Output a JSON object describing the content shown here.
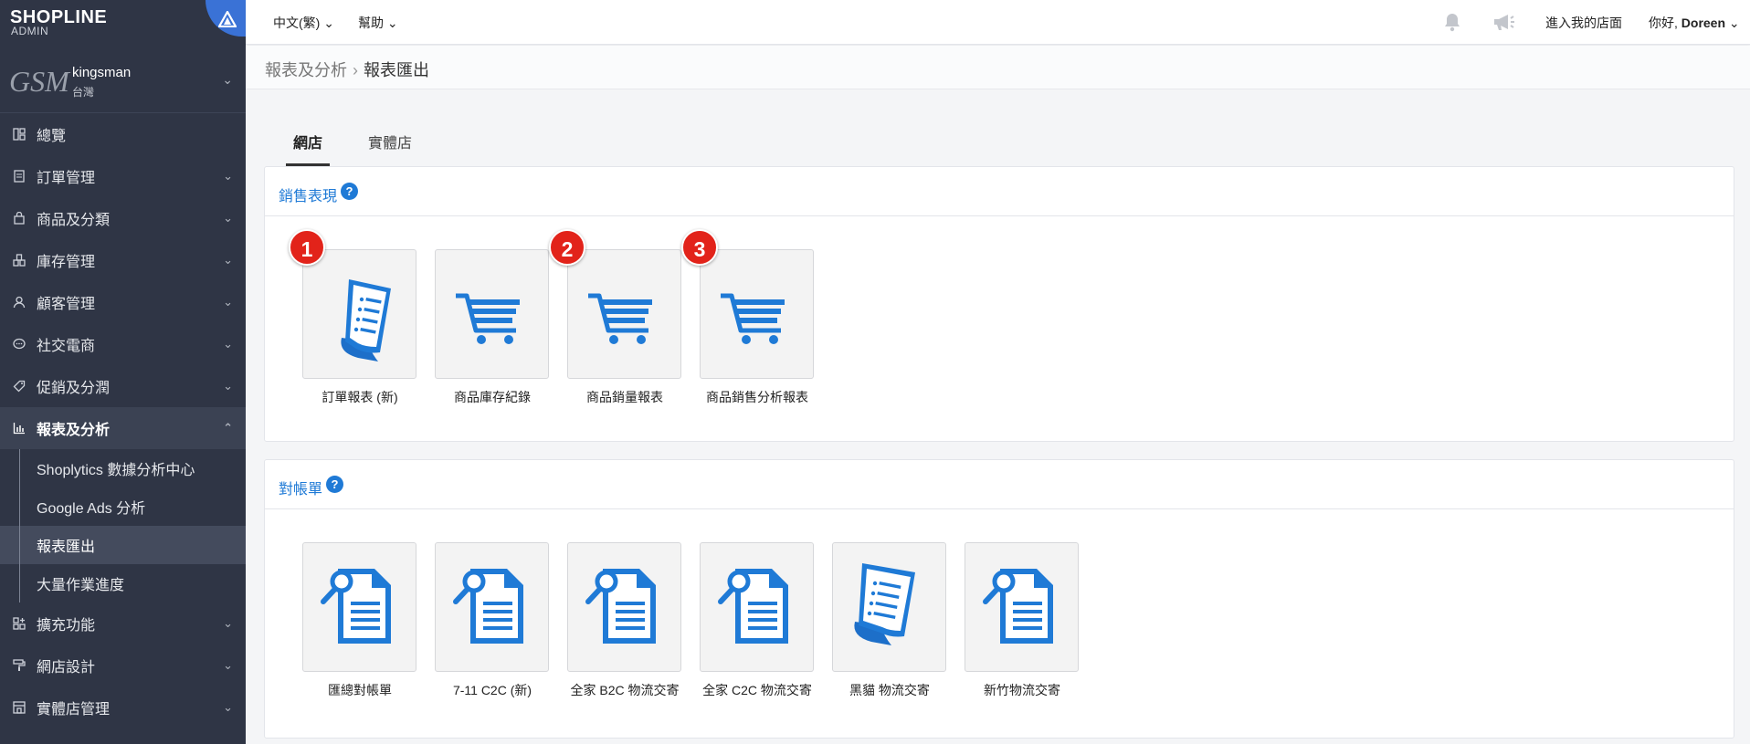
{
  "brand": {
    "logo": "SHOPLINE",
    "sub": "ADMIN"
  },
  "store": {
    "logo_text": "GSM",
    "name": "kingsman",
    "region": "台灣"
  },
  "sidebar": {
    "items": [
      {
        "label": "總覽",
        "icon": "dashboard-icon",
        "has_chevron": false
      },
      {
        "label": "訂單管理",
        "icon": "order-icon",
        "has_chevron": true
      },
      {
        "label": "商品及分類",
        "icon": "bag-icon",
        "has_chevron": true
      },
      {
        "label": "庫存管理",
        "icon": "warehouse-icon",
        "has_chevron": true
      },
      {
        "label": "顧客管理",
        "icon": "user-icon",
        "has_chevron": true
      },
      {
        "label": "社交電商",
        "icon": "chat-icon",
        "has_chevron": true
      },
      {
        "label": "促銷及分潤",
        "icon": "tag-icon",
        "has_chevron": true
      },
      {
        "label": "報表及分析",
        "icon": "chart-icon",
        "has_chevron": true,
        "active": true
      },
      {
        "label": "擴充功能",
        "icon": "apps-icon",
        "has_chevron": true
      },
      {
        "label": "網店設計",
        "icon": "paint-roller-icon",
        "has_chevron": true
      },
      {
        "label": "實體店管理",
        "icon": "shop-icon",
        "has_chevron": true
      }
    ],
    "sub_items": [
      {
        "label": "Shoplytics 數據分析中心"
      },
      {
        "label": "Google Ads 分析"
      },
      {
        "label": "報表匯出",
        "current": true
      },
      {
        "label": "大量作業進度"
      }
    ]
  },
  "topbar": {
    "language": "中文(繁)",
    "help": "幫助",
    "enter_store": "進入我的店面",
    "greeting": "你好,",
    "user": "Doreen"
  },
  "breadcrumb": {
    "parent": "報表及分析",
    "current": "報表匯出"
  },
  "tabs": [
    {
      "label": "網店",
      "active": true
    },
    {
      "label": "實體店",
      "active": false
    }
  ],
  "sections": {
    "sales": {
      "title": "銷售表現",
      "tiles": [
        {
          "label": "訂單報表 (新)",
          "icon": "receipt-icon",
          "badge": "1"
        },
        {
          "label": "商品庫存紀錄",
          "icon": "cart-icon",
          "badge": ""
        },
        {
          "label": "商品銷量報表",
          "icon": "cart-icon",
          "badge": "2"
        },
        {
          "label": "商品銷售分析報表",
          "icon": "cart-icon",
          "badge": "3"
        }
      ]
    },
    "reconcile": {
      "title": "對帳單",
      "tiles": [
        {
          "label": "匯總對帳單",
          "icon": "document-search-icon"
        },
        {
          "label": "7-11 C2C (新)",
          "icon": "document-search-icon"
        },
        {
          "label": "全家 B2C 物流交寄",
          "icon": "document-search-icon"
        },
        {
          "label": "全家 C2C 物流交寄",
          "icon": "document-search-icon"
        },
        {
          "label": "黑貓 物流交寄",
          "icon": "receipt-icon"
        },
        {
          "label": "新竹物流交寄",
          "icon": "document-search-icon"
        }
      ]
    }
  },
  "colors": {
    "sidebar_bg": "#2f3545",
    "accent_blue": "#1f7ad6",
    "badge_red": "#e2231a"
  }
}
